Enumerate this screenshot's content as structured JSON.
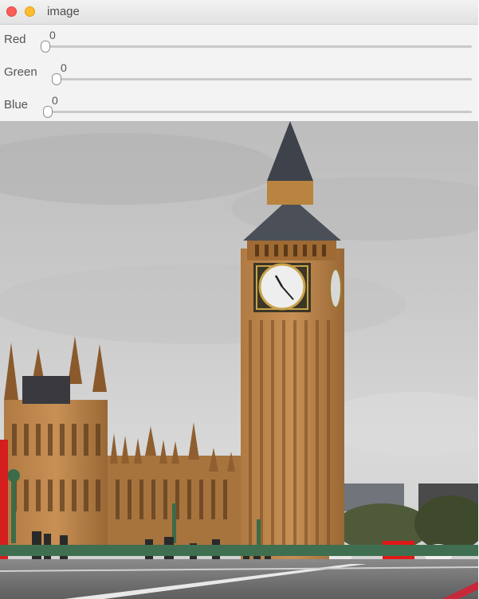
{
  "window": {
    "title": "image",
    "buttons": {
      "close": "close",
      "minimize": "minimize"
    }
  },
  "trackbars": [
    {
      "label": "Red",
      "value": "0"
    },
    {
      "label": "Green",
      "value": "0"
    },
    {
      "label": "Blue",
      "value": "0"
    }
  ],
  "colors": {
    "close": "#fc5d58",
    "minimize": "#fdbb2e",
    "panel": "#f3f3f3"
  }
}
